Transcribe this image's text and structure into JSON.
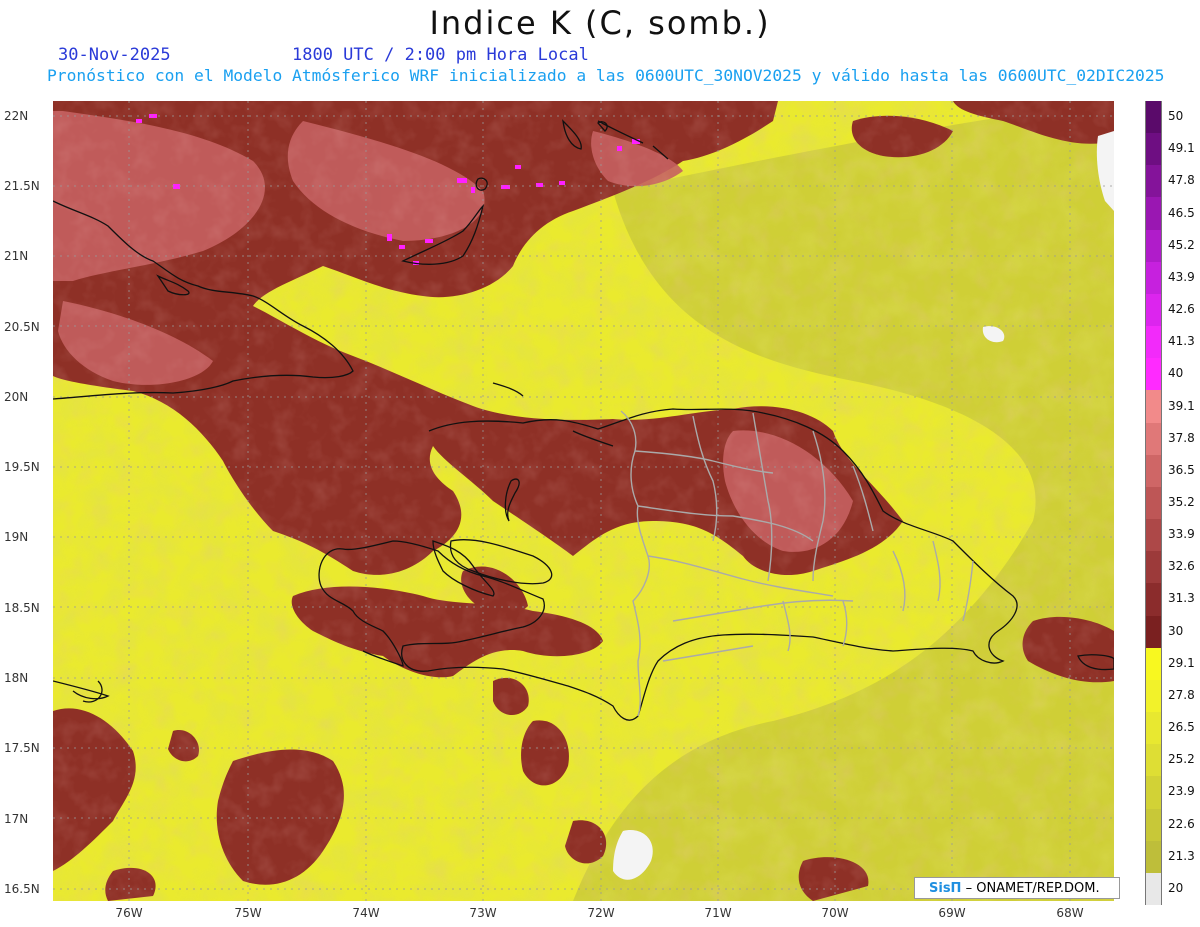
{
  "title": "Indice K (C, somb.)",
  "date": "30-Nov-2025",
  "time": "1800 UTC / 2:00 pm Hora Local",
  "model_info": "Pronóstico con el Modelo Atmósferico WRF inicializado a las 0600UTC_30NOV2025 y válido hasta las  0600UTC_02DIC2025",
  "credit": {
    "logo": "SisΠ",
    "text": "– ONAMET/REP.DOM."
  },
  "lat_labels": [
    "22N",
    "21.5N",
    "21N",
    "20.5N",
    "20N",
    "19.5N",
    "19N",
    "18.5N",
    "18N",
    "17.5N",
    "17N",
    "16.5N"
  ],
  "lon_labels": [
    "76W",
    "75W",
    "74W",
    "73W",
    "72W",
    "71W",
    "70W",
    "69W",
    "68W"
  ],
  "colorbar": {
    "labels": [
      "50",
      "49.1",
      "47.8",
      "46.5",
      "45.2",
      "43.9",
      "42.6",
      "41.3",
      "40",
      "39.1",
      "37.8",
      "36.5",
      "35.2",
      "33.9",
      "32.6",
      "31.3",
      "30",
      "29.1",
      "27.8",
      "26.5",
      "25.2",
      "23.9",
      "22.6",
      "21.3",
      "20"
    ],
    "colors": [
      "#5a0a6a",
      "#6e0e82",
      "#84139a",
      "#9a17b2",
      "#b01cca",
      "#c621de",
      "#dc25ee",
      "#f22afa",
      "#ff2aff",
      "#f28a8a",
      "#e07878",
      "#cf6666",
      "#be5656",
      "#ad4848",
      "#9c3a3a",
      "#8b2c2c",
      "#7a2020",
      "#f8f820",
      "#f2f22a",
      "#e8e830",
      "#dede34",
      "#d2d236",
      "#c8c838",
      "#bebe3a",
      "#e8e8e8"
    ]
  },
  "colors": {
    "yellow_field": "#eaea2e",
    "dark_field": "#c2c23c",
    "brown_field": "#8e3026",
    "salmon_field": "#c56060",
    "magenta": "#ff20ff"
  }
}
